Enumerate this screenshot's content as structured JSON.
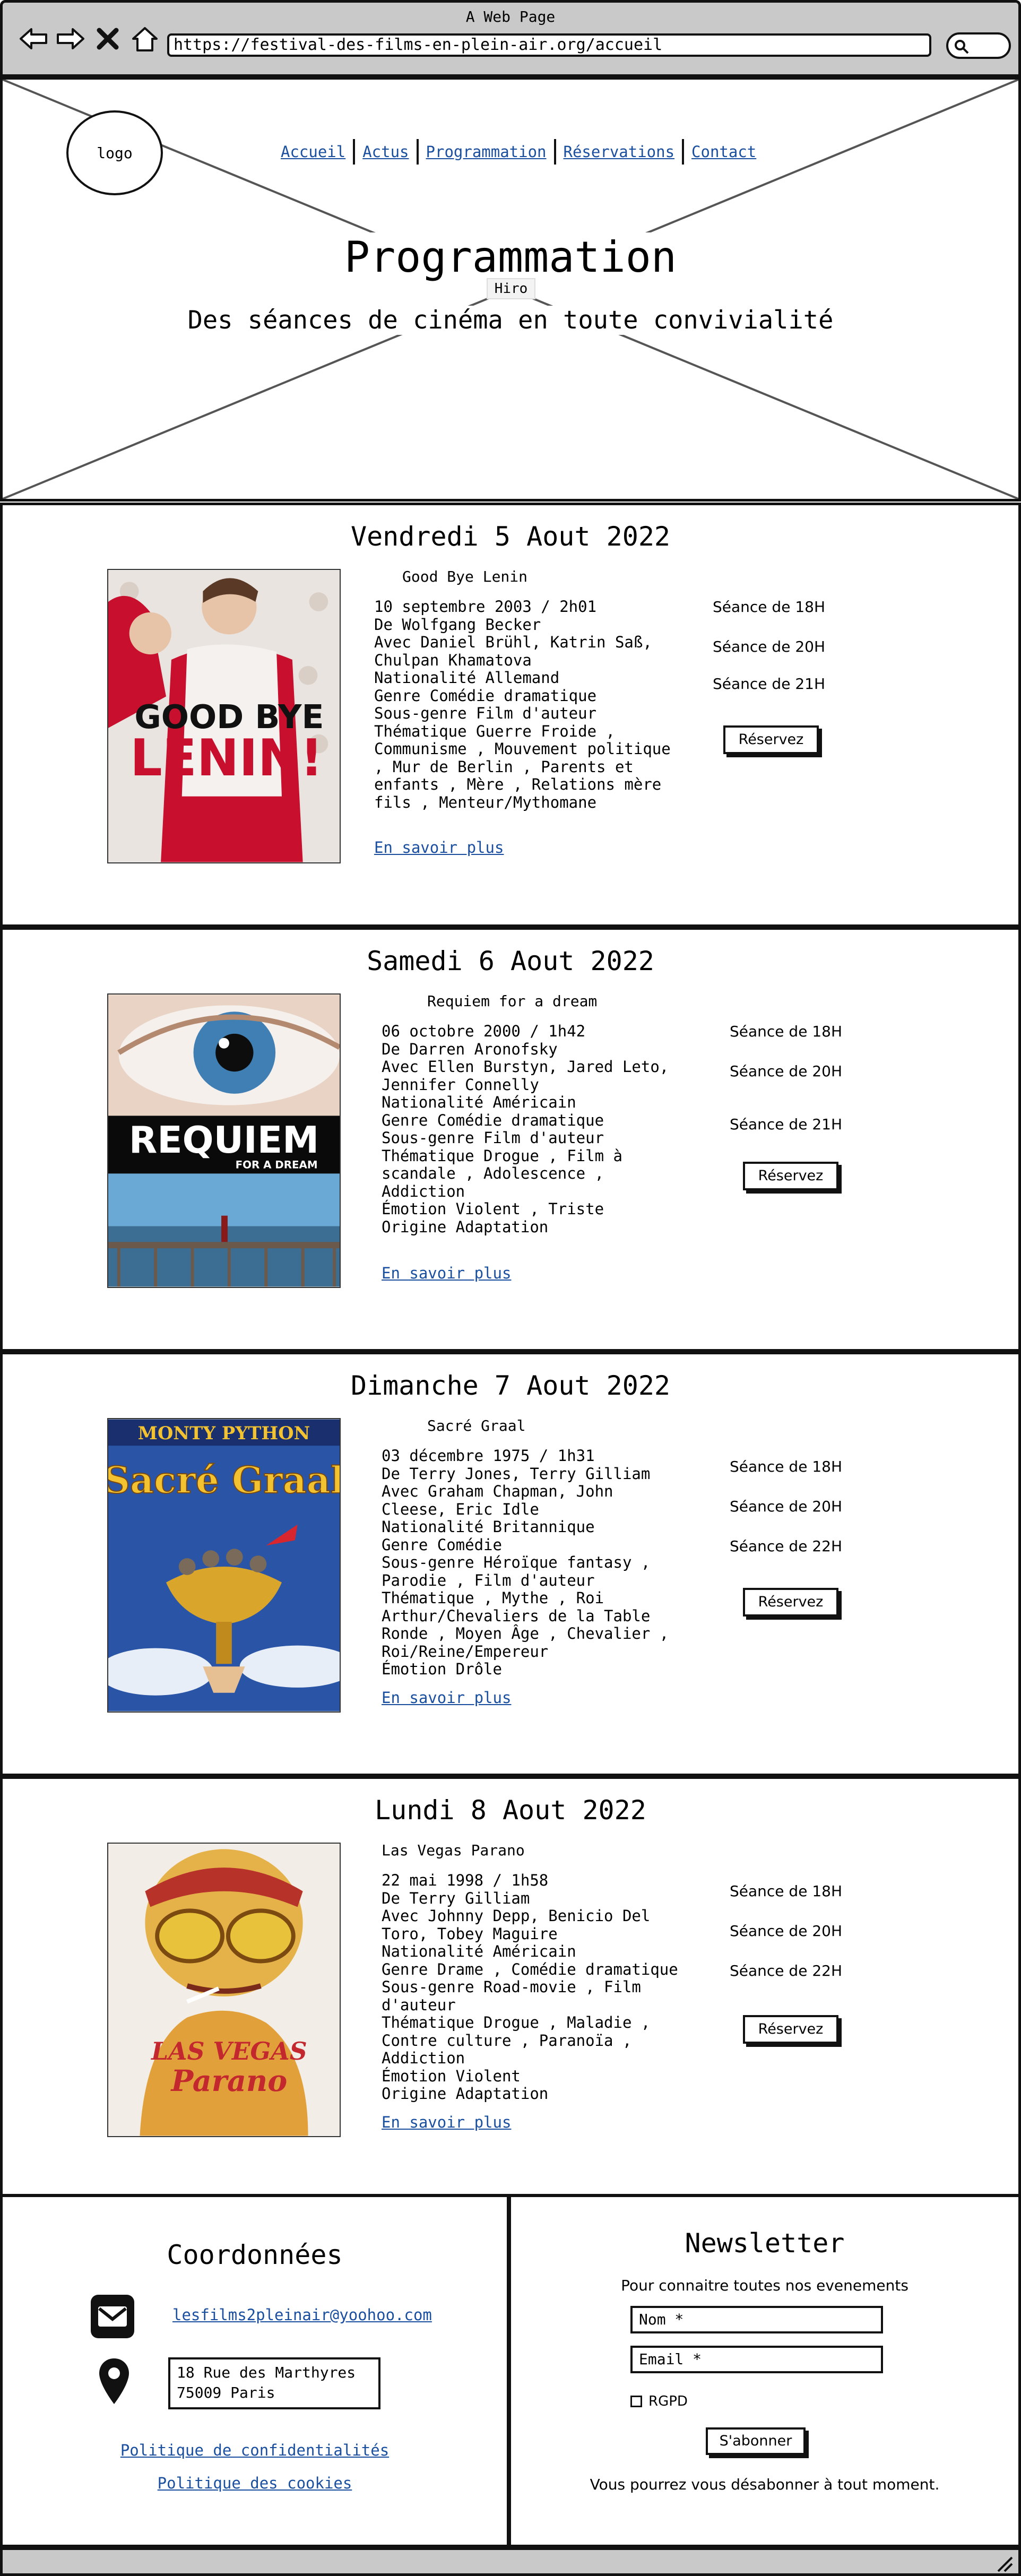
{
  "browser": {
    "title": "A Web Page",
    "url": "https://festival-des-films-en-plein-air.org/accueil"
  },
  "header": {
    "logo": "logo",
    "nav": [
      "Accueil",
      "Actus",
      "Programmation",
      "Réservations",
      "Contact"
    ],
    "title": "Programmation",
    "hiro": "Hiro",
    "subtitle": "Des séances de cinéma en toute convivialité"
  },
  "days": [
    {
      "date": "Vendredi 5 Aout 2022",
      "film": "Good Bye Lenin",
      "info": "10 septembre 2003 / 2h01\nDe Wolfgang Becker\nAvec Daniel Brühl, Katrin Saß,\nChulpan Khamatova\nNationalité Allemand\nGenre Comédie dramatique\nSous-genre Film d'auteur\nThématique Guerre Froide ,\nCommunisme , Mouvement politique\n, Mur de Berlin , Parents et\nenfants , Mère , Relations mère\nfils , Menteur/Mythomane",
      "more": "En savoir plus",
      "seances": [
        "Séance de 18H",
        "Séance de 20H",
        "Séance de 21H"
      ],
      "reserve": "Réservez"
    },
    {
      "date": "Samedi 6 Aout 2022",
      "film": "Requiem for a dream",
      "info": "06 octobre 2000 / 1h42\nDe Darren Aronofsky\nAvec Ellen Burstyn, Jared Leto,\nJennifer Connelly\nNationalité Américain\nGenre Comédie dramatique\nSous-genre Film d'auteur\nThématique Drogue , Film à\nscandale , Adolescence ,\nAddiction\nÉmotion Violent , Triste\nOrigine Adaptation",
      "more": "En savoir plus",
      "seances": [
        "Séance de 18H",
        "Séance de 20H",
        "Séance de 21H"
      ],
      "reserve": "Réservez"
    },
    {
      "date": "Dimanche 7 Aout 2022",
      "film": "Sacré Graal",
      "info": "03 décembre 1975 / 1h31\nDe Terry Jones, Terry Gilliam\nAvec Graham Chapman, John\nCleese, Eric Idle\nNationalité Britannique\nGenre Comédie\nSous-genre Héroïque fantasy ,\nParodie , Film d'auteur\nThématique , Mythe , Roi\nArthur/Chevaliers de la Table\nRonde , Moyen Âge , Chevalier ,\nRoi/Reine/Empereur\nÉmotion Drôle",
      "more": "En savoir plus",
      "seances": [
        "Séance de 18H",
        "Séance de 20H",
        "Séance de 22H"
      ],
      "reserve": "Réservez"
    },
    {
      "date": "Lundi 8 Aout 2022",
      "film": "Las Vegas Parano",
      "info": "22 mai 1998 / 1h58\nDe Terry Gilliam\nAvec Johnny Depp, Benicio Del\nToro, Tobey Maguire\nNationalité Américain\nGenre Drame , Comédie dramatique\nSous-genre Road-movie , Film\nd'auteur\nThématique Drogue , Maladie ,\nContre culture , Paranoïa ,\nAddiction\nÉmotion Violent\nOrigine Adaptation",
      "more": "En savoir plus",
      "seances": [
        "Séance de 18H",
        "Séance de 20H",
        "Séance de 22H"
      ],
      "reserve": "Réservez"
    }
  ],
  "posters": {
    "p1": {
      "line1": "GOOD BYE",
      "line2": "LENIN!"
    },
    "p2": {
      "line1": "REQUIEM",
      "line2": "FOR A DREAM"
    },
    "p3": {
      "line1": "MONTY PYTHON",
      "line2": "Sacré Graal"
    },
    "p4": {
      "line1": "LAS VEGAS",
      "line2": "Parano"
    }
  },
  "footer": {
    "coords_title": "Coordonnées",
    "email": "lesfilms2pleinair@yoohoo.com",
    "address_line1": "18 Rue des Marthyres",
    "address_line2": "75009 Paris",
    "privacy": "Politique de confidentialités",
    "cookies": "Politique des cookies",
    "newsletter_title": "Newsletter",
    "newsletter_intro": "Pour connaitre toutes nos evenements",
    "name_placeholder": "Nom *",
    "email_placeholder": "Email *",
    "rgpd": "RGPD",
    "subscribe": "S'abonner",
    "unsubscribe_note": "Vous pourrez vous désabonner à tout moment."
  },
  "colors": {
    "chrome": "#c9c9c9",
    "link": "#1a4fa0",
    "border": "#111111"
  }
}
